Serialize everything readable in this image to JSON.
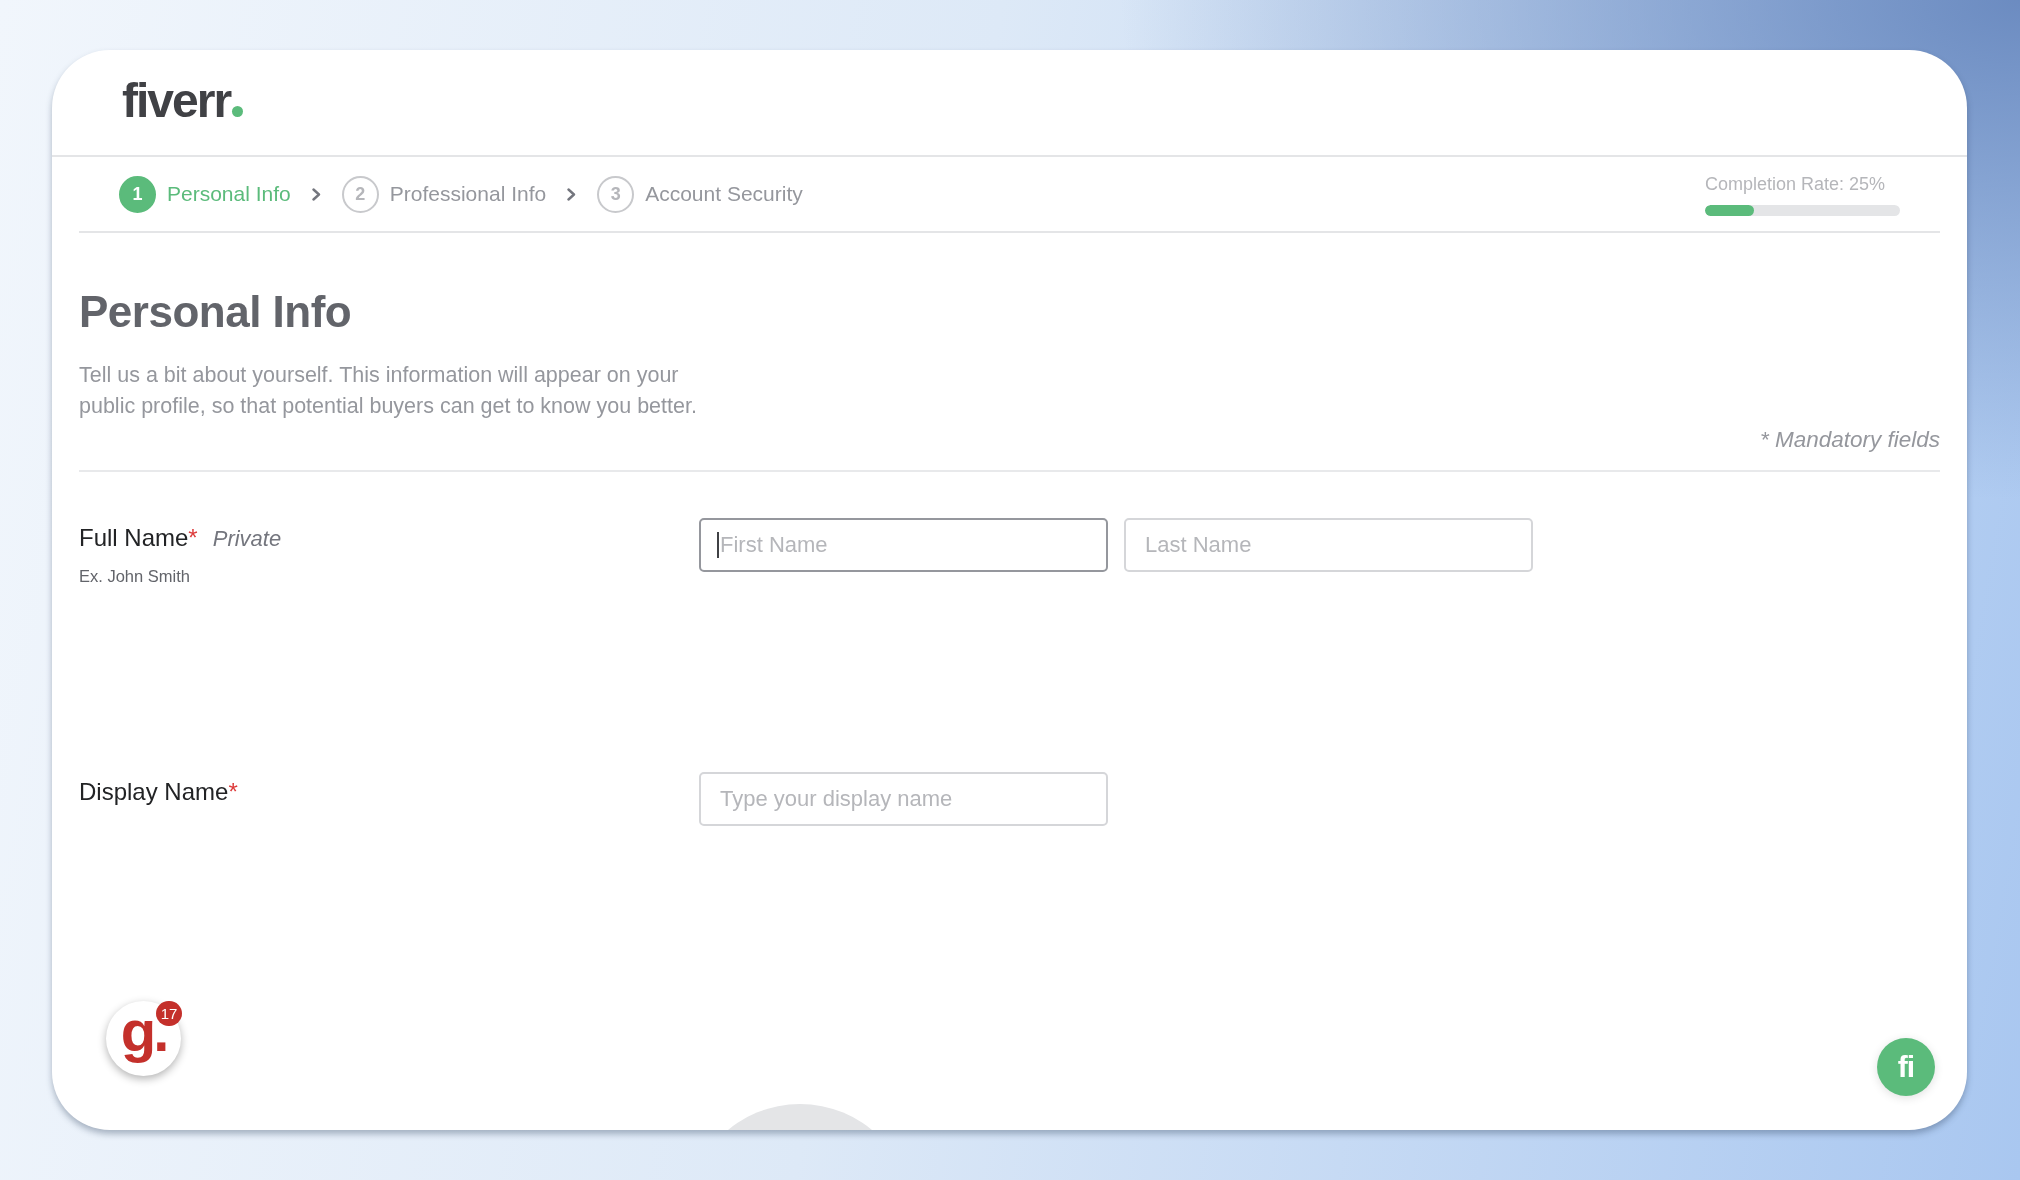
{
  "logo": {
    "text": "fiverr"
  },
  "steps": [
    {
      "number": "1",
      "label": "Personal Info",
      "selected": true
    },
    {
      "number": "2",
      "label": "Professional Info",
      "selected": false
    },
    {
      "number": "3",
      "label": "Account Security",
      "selected": false
    }
  ],
  "completion": {
    "label": "Completion Rate: 25%",
    "level": 0.25
  },
  "page": {
    "title": "Personal Info",
    "description": "Tell us a bit about yourself. This information will appear on your public profile, so that potential buyers can get to know you better.",
    "mandatory_note": "* Mandatory fields"
  },
  "fields": [
    {
      "label": "Full Name",
      "required_mark": "*",
      "note": "Private",
      "hint": "Ex. John Smith",
      "inputs": [
        {
          "placeholder": "First Name",
          "focused": true
        },
        {
          "placeholder": "Last Name",
          "focused": false
        }
      ]
    },
    {
      "label": "Display Name",
      "required_mark": "*",
      "inputs": [
        {
          "placeholder": "Type your display name",
          "focused": false
        }
      ]
    }
  ],
  "help_widget": {
    "logo": "g.",
    "count": "17"
  },
  "chat_button": {
    "label": "fi"
  }
}
